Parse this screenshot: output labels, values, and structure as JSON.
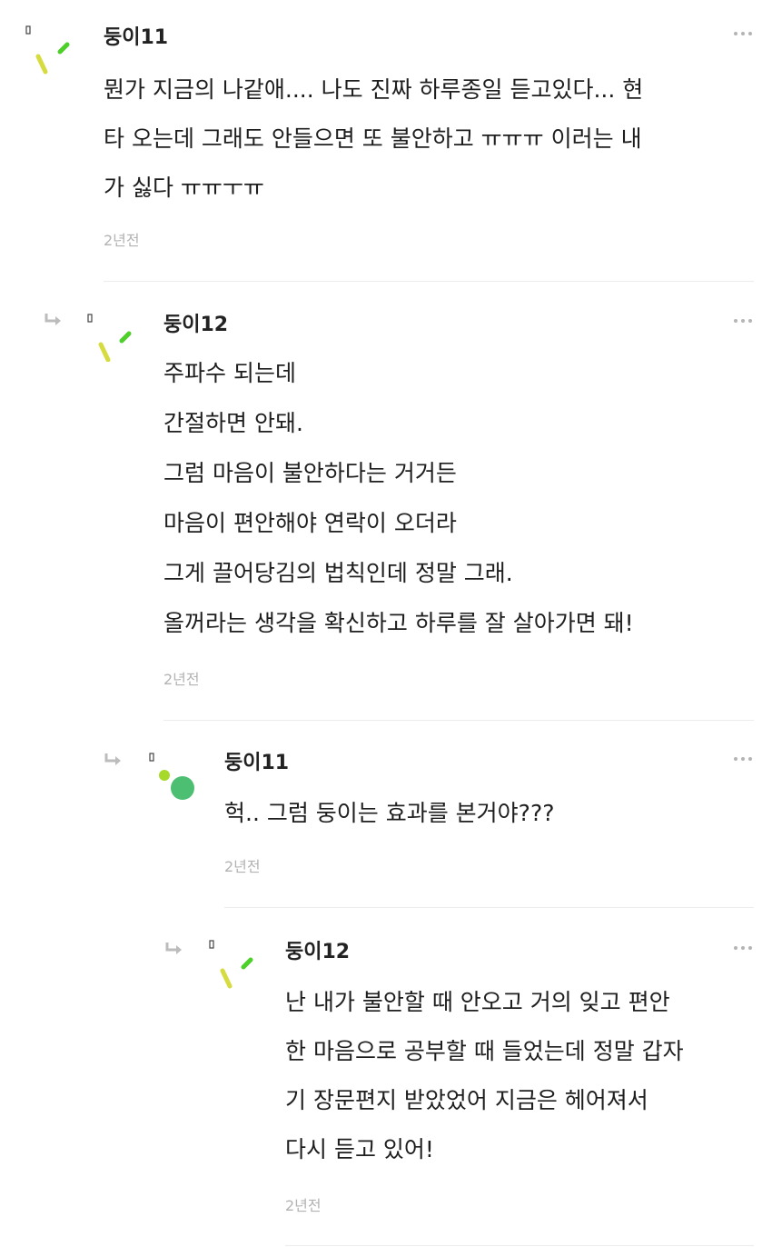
{
  "comments": [
    {
      "author": "둥이11",
      "text": "뭔가 지금의 나같애.... 나도 진짜 하루종일 듣고있다... 현\n타 오는데 그래도 안들으면 또 불안하고 ㅠㅠㅠ 이러는 내\n가 싫다 ㅠㅠㅜㅠ",
      "time": "2년전",
      "avatar": "yellow-green-stick-avatar",
      "is_reply": false
    },
    {
      "author": "둥이12",
      "text": "주파수 되는데\n간절하면 안돼.\n그럼 마음이 불안하다는 거거든\n마음이 편안해야 연락이 오더라\n그게 끌어당김의 법칙인데 정말 그래.\n올꺼라는 생각을 확신하고 하루를 잘 살아가면 돼!",
      "time": "2년전",
      "avatar": "yellow-green-stick-avatar",
      "is_reply": true
    },
    {
      "author": "둥이11",
      "text": "헉.. 그럼 둥이는 효과를 본거야???",
      "time": "2년전",
      "avatar": "green-dot-avatar",
      "is_reply": true
    },
    {
      "author": "둥이12",
      "text": "난 내가 불안할 때 안오고 거의 잊고 편안\n한 마음으로 공부할 때 들었는데 정말 갑자\n기 장문편지 받았었어 지금은 헤어져서\n다시 듣고 있어!",
      "time": "2년전",
      "avatar": "yellow-green-stick-avatar",
      "is_reply": true
    }
  ],
  "icons": {
    "reply": "reply-arrow-icon",
    "more": "more-options-icon"
  },
  "colors": {
    "stick_yellow": "#d6dc3f",
    "stick_green": "#4fcf2a",
    "dot_lime": "#a6d92a",
    "dot_green": "#4cbf73",
    "meta_gray": "#b3b3b3"
  }
}
